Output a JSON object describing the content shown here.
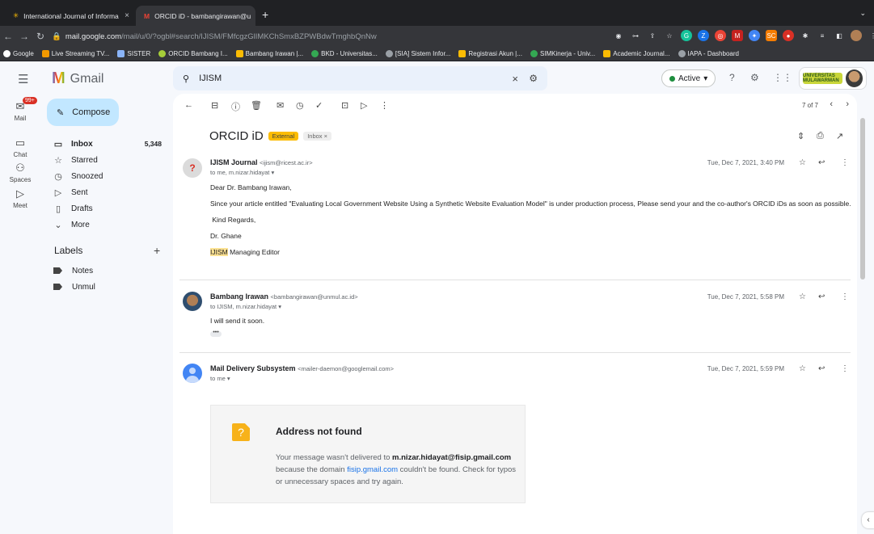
{
  "browser": {
    "tabs": [
      {
        "title": "International Journal of Informa",
        "icon": "journal-icon",
        "active": false
      },
      {
        "title": "ORCID iD - bambangirawan@u",
        "icon": "gmail-icon",
        "active": true
      }
    ],
    "url_domain": "mail.google.com",
    "url_path": "/mail/u/0/?ogbl#search/IJISM/FMfcgzGlIMKChSmxBZPWBdwTmghbQnNw",
    "bookmarks": [
      "Google",
      "Live Streaming TV...",
      "SISTER",
      "ORCID Bambang I...",
      "Bambang Irawan |...",
      "BKD - Universitas...",
      "[SIA] Sistem Infor...",
      "Registrasi Akun |...",
      "SIMKinerja - Univ...",
      "Academic Journal...",
      "IAPA - Dashboard"
    ]
  },
  "gmail": {
    "brand": "Gmail",
    "search_value": "IJISM",
    "status": "Active",
    "compose_label": "Compose",
    "rail": [
      {
        "label": "Mail",
        "badge": "99+"
      },
      {
        "label": "Chat"
      },
      {
        "label": "Spaces"
      },
      {
        "label": "Meet"
      }
    ],
    "nav": [
      {
        "label": "Inbox",
        "count": "5,348"
      },
      {
        "label": "Starred"
      },
      {
        "label": "Snoozed"
      },
      {
        "label": "Sent"
      },
      {
        "label": "Drafts"
      },
      {
        "label": "More"
      }
    ],
    "labels_title": "Labels",
    "labels": [
      "Notes",
      "Unmul"
    ],
    "account_badge": "UNIVERSITAS MULAWARMAN"
  },
  "thread": {
    "pager": "7 of 7",
    "subject": "ORCID iD",
    "tag_external": "External",
    "tag_inbox": "Inbox ×",
    "messages": [
      {
        "sender": "IJISM Journal",
        "email": "<ijism@ricest.ac.ir>",
        "to": "to me, m.nizar.hidayat ▾",
        "date": "Tue, Dec 7, 2021, 3:40 PM",
        "lines": [
          "Dear Dr. Bambang Irawan,",
          "Since your article entitled \"Evaluating Local Government Website Using a Synthetic Website Evaluation Model\" is under production process, Please send your and the co-author's ORCID iDs as soon as possible.",
          " Kind Regards,",
          "Dr. Ghane"
        ],
        "sig_highlight": "IJISM",
        "sig_rest": " Managing Editor"
      },
      {
        "sender": "Bambang Irawan",
        "email": "<bambangirawan@unmul.ac.id>",
        "to": "to IJISM, m.nizar.hidayat ▾",
        "date": "Tue, Dec 7, 2021, 5:58 PM",
        "lines": [
          "I will send it soon."
        ]
      },
      {
        "sender": "Mail Delivery Subsystem",
        "email": "<mailer-daemon@googlemail.com>",
        "to": "to me ▾",
        "date": "Tue, Dec 7, 2021, 5:59 PM"
      }
    ],
    "bounce": {
      "title": "Address not found",
      "text1": "Your message wasn't delivered to ",
      "address": "m.nizar.hidayat@fisip.gmail.com",
      "text2": " because the domain ",
      "domain": "fisip.gmail.com",
      "text3": " couldn't be found. Check for typos or unnecessary spaces and try again."
    }
  }
}
